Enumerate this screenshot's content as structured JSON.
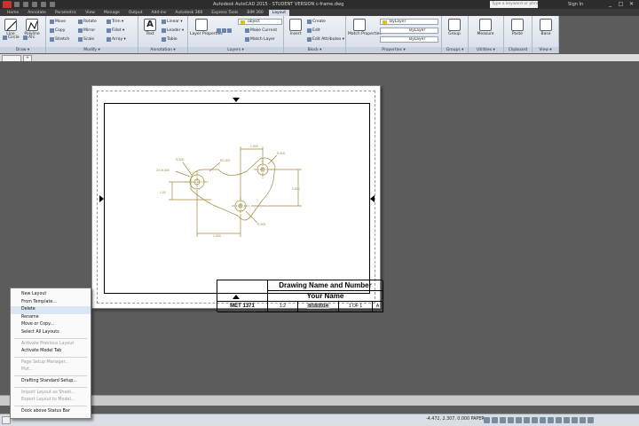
{
  "window": {
    "title": "Autodesk AutoCAD 2015 - STUDENT VERSION    c-frame.dwg",
    "search_placeholder": "Type a keyword or phrase",
    "sign_in": "Sign In"
  },
  "ribbon_tabs": [
    "Home",
    "Annotate",
    "Parametric",
    "View",
    "Manage",
    "Output",
    "Add-ins",
    "Autodesk 360",
    "Express Tools",
    "BIM 360",
    "Layout"
  ],
  "active_tab": "Layout",
  "ribbon": {
    "draw": {
      "line": "Line",
      "polyline": "Polyline",
      "circle": "Circle",
      "arc": "Arc",
      "label": "Draw ▾"
    },
    "modify": {
      "move": "Move",
      "rotate": "Rotate",
      "trim": "Trim ▾",
      "copy": "Copy",
      "mirror": "Mirror",
      "fillet": "Fillet ▾",
      "stretch": "Stretch",
      "scale": "Scale",
      "array": "Array ▾",
      "label": "Modify ▾"
    },
    "annotation": {
      "text": "Text",
      "dimension": "Dimension",
      "linear": "Linear ▾",
      "leader": "Leader ▾",
      "table": "Table",
      "label": "Annotation ▾"
    },
    "layers": {
      "properties": "Layer Properties",
      "layer_name": "object",
      "make_current": "Make Current",
      "match_layer": "Match Layer",
      "label": "Layers ▾"
    },
    "block": {
      "insert": "Insert",
      "create": "Create",
      "edit": "Edit",
      "edit_attributes": "Edit Attributes ▾",
      "label": "Block ▾"
    },
    "properties": {
      "match": "Match Properties",
      "color": "ByLayer",
      "linetype": "ByLayer",
      "lineweight": "ByLayer",
      "label": "Properties ▾"
    },
    "groups": {
      "group": "Group",
      "label": "Groups ▾"
    },
    "utilities": {
      "measure": "Measure",
      "label": "Utilities ▾"
    },
    "clipboard": {
      "paste": "Paste",
      "label": "Clipboard"
    },
    "view": {
      "base": "Base",
      "label": "View ▾"
    }
  },
  "title_block": {
    "drawing_name": "Drawing Name and Number",
    "your_name": "Your Name",
    "course": "MET 1371",
    "scale": "1:2",
    "date": "8/18/2014",
    "sheet": "1 OF 1",
    "rev": "A"
  },
  "status": {
    "coords": "-4.472, 2.307, 0.000",
    "mode": "PAPER"
  },
  "context_menu": {
    "items": [
      {
        "label": "New Layout",
        "enabled": true
      },
      {
        "label": "From Template...",
        "enabled": true
      },
      {
        "label": "Delete",
        "enabled": true
      },
      {
        "label": "Rename",
        "enabled": true
      },
      {
        "label": "Move or Copy...",
        "enabled": true
      },
      {
        "label": "Select All Layouts",
        "enabled": true
      },
      {
        "label": "Activate Previous Layout",
        "enabled": false
      },
      {
        "label": "Activate Model Tab",
        "enabled": true
      },
      {
        "label": "Page Setup Manager...",
        "enabled": false
      },
      {
        "label": "Plot...",
        "enabled": false
      },
      {
        "label": "Drafting Standard Setup...",
        "enabled": true
      },
      {
        "label": "Import Layout as Sheet...",
        "enabled": false
      },
      {
        "label": "Export Layout to Model...",
        "enabled": false
      },
      {
        "label": "Dock above Status Bar",
        "enabled": true
      }
    ]
  }
}
